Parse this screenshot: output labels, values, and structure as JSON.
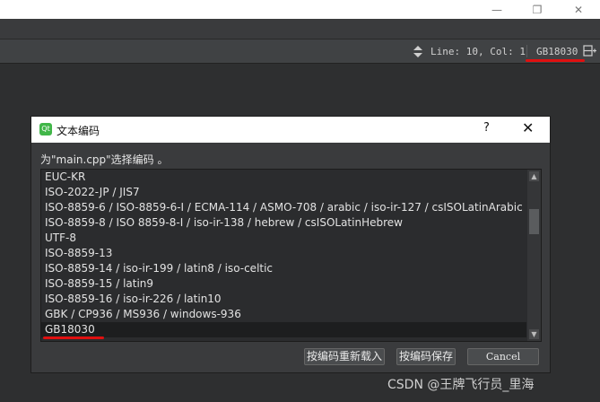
{
  "window": {
    "minimize_icon": "minimize-icon",
    "restore_icon": "restore-icon",
    "close_icon": "close-icon"
  },
  "statusbar": {
    "position": "Line: 10, Col: 1",
    "encoding": "GB18030",
    "split_icon": "split-icon"
  },
  "dialog": {
    "title": "文本编码",
    "help": "?",
    "close": "✕",
    "prompt": "为\"main.cpp\"选择编码 。",
    "encodings": [
      "EUC-KR",
      "ISO-2022-JP / JIS7",
      "ISO-8859-6 / ISO-8859-6-I / ECMA-114 / ASMO-708 / arabic / iso-ir-127 / csISOLatinArabic",
      "ISO-8859-8 / ISO 8859-8-I / iso-ir-138 / hebrew / csISOLatinHebrew",
      "UTF-8",
      "ISO-8859-13",
      "ISO-8859-14 / iso-ir-199 / latin8 / iso-celtic",
      "ISO-8859-15 / latin9",
      "ISO-8859-16 / iso-ir-226 / latin10",
      "GBK / CP936 / MS936 / windows-936",
      "GB18030"
    ],
    "selected": "GB18030",
    "buttons": {
      "reload": "按编码重新载入",
      "save": "按编码保存",
      "cancel": "Cancel"
    }
  },
  "watermark": "CSDN @王牌飞行员_里海",
  "colors": {
    "highlight_underline": "#e01010",
    "dialog_bg": "#3a3b3d",
    "list_bg": "#2b2c2e"
  }
}
